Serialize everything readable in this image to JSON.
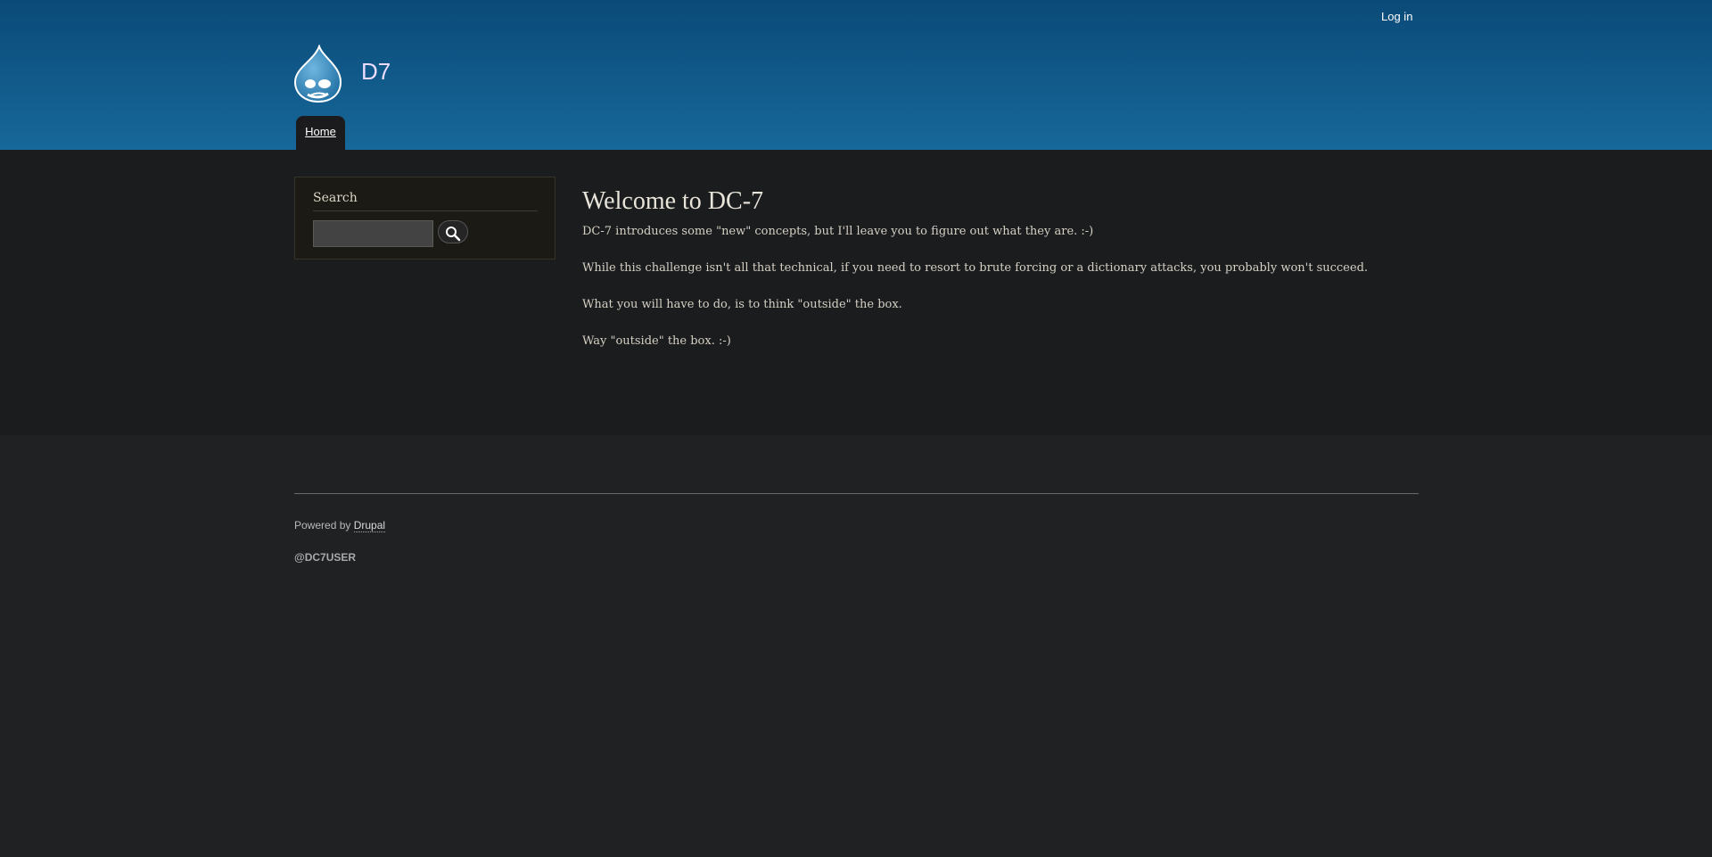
{
  "header": {
    "login_label": "Log in",
    "site_name": "D7",
    "logo_icon": "drupal-drop-icon",
    "nav": {
      "home_label": "Home"
    },
    "colors": {
      "gradient_top": "#0a4a78",
      "gradient_bottom": "#17689a",
      "site_name": "#ecdcff"
    }
  },
  "sidebar": {
    "search": {
      "title": "Search",
      "input_value": "",
      "button_icon": "search-icon"
    }
  },
  "main": {
    "title": "Welcome to DC-7",
    "paragraphs": [
      "DC-7 introduces some \"new\" concepts, but I'll leave you to figure out what they are.  :-)",
      "While this challenge isn't all that technical, if you need to resort to brute forcing or a dictionary attacks, you probably won't succeed.",
      "What you will have to do, is to think \"outside\" the box.",
      "Way \"outside\" the box.  :-)"
    ]
  },
  "footer": {
    "powered_prefix": "Powered by ",
    "powered_link": "Drupal",
    "user_handle": "@DC7USER"
  }
}
